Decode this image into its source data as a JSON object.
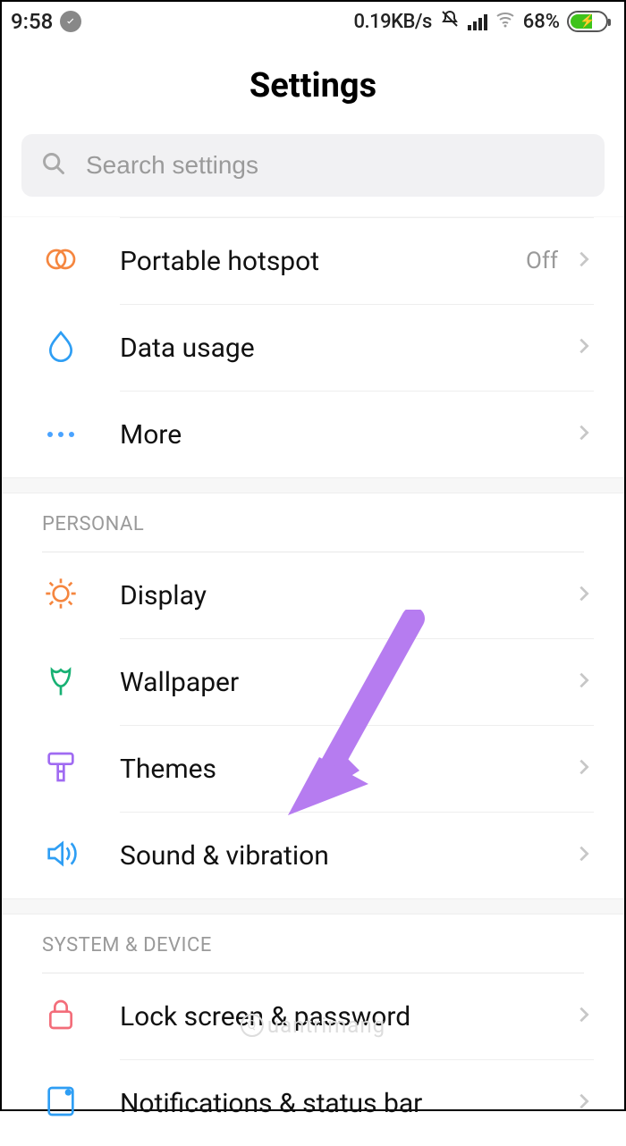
{
  "status_bar": {
    "time": "9:58",
    "net_speed": "0.19KB/s",
    "battery_pct": "68%"
  },
  "header": {
    "title": "Settings"
  },
  "search": {
    "placeholder": "Search settings"
  },
  "groups": {
    "wireless": {
      "items": [
        {
          "key": "hotspot",
          "label": "Portable hotspot",
          "value": "Off"
        },
        {
          "key": "datausage",
          "label": "Data usage"
        },
        {
          "key": "more",
          "label": "More"
        }
      ]
    },
    "personal": {
      "title": "PERSONAL",
      "items": [
        {
          "key": "display",
          "label": "Display"
        },
        {
          "key": "wallpaper",
          "label": "Wallpaper"
        },
        {
          "key": "themes",
          "label": "Themes"
        },
        {
          "key": "sound",
          "label": "Sound & vibration"
        }
      ]
    },
    "system": {
      "title": "SYSTEM & DEVICE",
      "items": [
        {
          "key": "lockscreen",
          "label": "Lock screen & password"
        },
        {
          "key": "notifications",
          "label": "Notifications & status bar"
        }
      ]
    }
  },
  "icon_colors": {
    "hotspot": "#f5863f",
    "datausage": "#2e9ef4",
    "more": "#4aa3ff",
    "display": "#f5863f",
    "wallpaper": "#18b174",
    "themes": "#a06bf2",
    "sound": "#2e9ef4",
    "lockscreen": "#f36d7a",
    "notifications": "#2e9ef4",
    "chevron": "#c7c7c7",
    "search": "#a8a8a8",
    "arrow": "#b67cf0"
  },
  "watermark": "uantrimang"
}
